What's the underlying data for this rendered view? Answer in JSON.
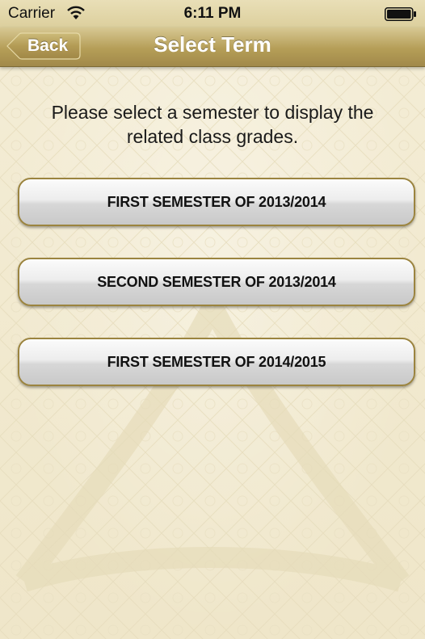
{
  "status_bar": {
    "carrier": "Carrier",
    "time": "6:11 PM",
    "wifi_icon": "wifi-icon",
    "battery_icon": "battery-icon"
  },
  "nav": {
    "back_label": "Back",
    "title": "Select Term"
  },
  "instructions": "Please select a semester to display the related class grades.",
  "terms": [
    {
      "label": "FIRST SEMESTER OF 2013/2014"
    },
    {
      "label": "SECOND SEMESTER OF 2013/2014"
    },
    {
      "label": "FIRST SEMESTER OF 2014/2015"
    }
  ],
  "colors": {
    "nav_gold": "#b59e57",
    "background": "#f3ecd3",
    "button_border": "#9b843f"
  }
}
